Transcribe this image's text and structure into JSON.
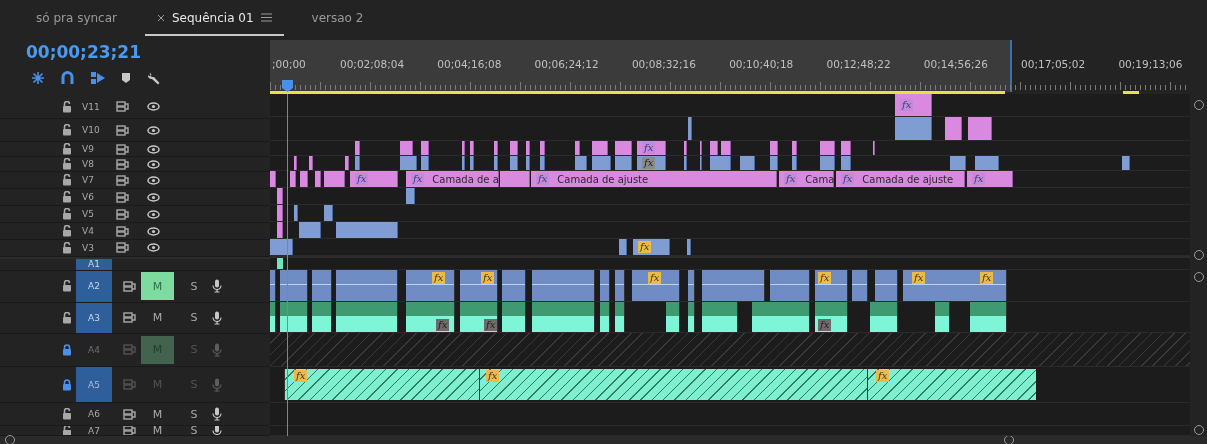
{
  "tabs": [
    {
      "label": "só pra syncar",
      "selected": false
    },
    {
      "label": "Sequência 01",
      "selected": true
    },
    {
      "label": "versao 2",
      "selected": false
    }
  ],
  "timecode": "00;00;23;21",
  "ruler_labels": [
    ";00;00",
    "00;02;08;04",
    "00;04;16;08",
    "00;06;24;12",
    "00;08;32;16",
    "00;10;40;18",
    "00;12;48;22",
    "00;14;56;26",
    "00;17;05;02",
    "00;19;13;06"
  ],
  "video_tracks": [
    {
      "name": "V11",
      "locked": false,
      "clip_labels": [
        {
          "fx": "fx"
        }
      ]
    },
    {
      "name": "V10",
      "locked": false
    },
    {
      "name": "V9",
      "locked": false,
      "clip_labels": [
        {
          "fx": "fx"
        }
      ]
    },
    {
      "name": "V8",
      "locked": false,
      "clip_labels": [
        {
          "fx": "fx"
        }
      ]
    },
    {
      "name": "V7",
      "locked": false,
      "clip_labels": [
        {
          "fx": "fx"
        },
        {
          "fx": "fx",
          "title": "Camada de a"
        },
        {
          "fx": "fx",
          "title": "Camada de ajuste"
        },
        {
          "fx": "fx",
          "title": "Cama"
        },
        {
          "fx": "fx",
          "title": "Camada de ajuste"
        },
        {
          "fx": "fx"
        }
      ]
    },
    {
      "name": "V6",
      "locked": false
    },
    {
      "name": "V5",
      "locked": false
    },
    {
      "name": "V4",
      "locked": false
    },
    {
      "name": "V3",
      "locked": false,
      "clip_labels": [
        {
          "fx": "fx"
        }
      ]
    }
  ],
  "audio_tracks": [
    {
      "name": "A1",
      "selected": true
    },
    {
      "name": "A2",
      "selected": true,
      "locked": false,
      "muted": true,
      "mute_label": "M",
      "solo_label": "S",
      "clip_labels": [
        {
          "fx": "fx"
        },
        {
          "fx": "fx"
        },
        {
          "fx": "fx"
        },
        {
          "fx": "fx"
        },
        {
          "fx": "fx"
        },
        {
          "fx": "fx"
        }
      ]
    },
    {
      "name": "A3",
      "selected": true,
      "locked": false,
      "muted": false,
      "mute_label": "M",
      "solo_label": "S",
      "clip_labels": [
        {
          "fx": "fx"
        },
        {
          "fx": "fx"
        },
        {
          "fx": "fx"
        }
      ]
    },
    {
      "name": "A4",
      "selected": false,
      "locked": true,
      "muted": true,
      "mute_label": "M",
      "solo_label": "S"
    },
    {
      "name": "A5",
      "selected": true,
      "locked": true,
      "muted": false,
      "mute_label": "M",
      "solo_label": "S",
      "clip_labels": [
        {
          "fx": "fx"
        },
        {
          "fx": "fx"
        },
        {
          "fx": "fx"
        }
      ]
    },
    {
      "name": "A6",
      "selected": false,
      "locked": false,
      "muted": false,
      "mute_label": "M",
      "solo_label": "S"
    },
    {
      "name": "A7",
      "selected": false,
      "locked": false,
      "muted": false,
      "mute_label": "M",
      "solo_label": "S"
    }
  ]
}
